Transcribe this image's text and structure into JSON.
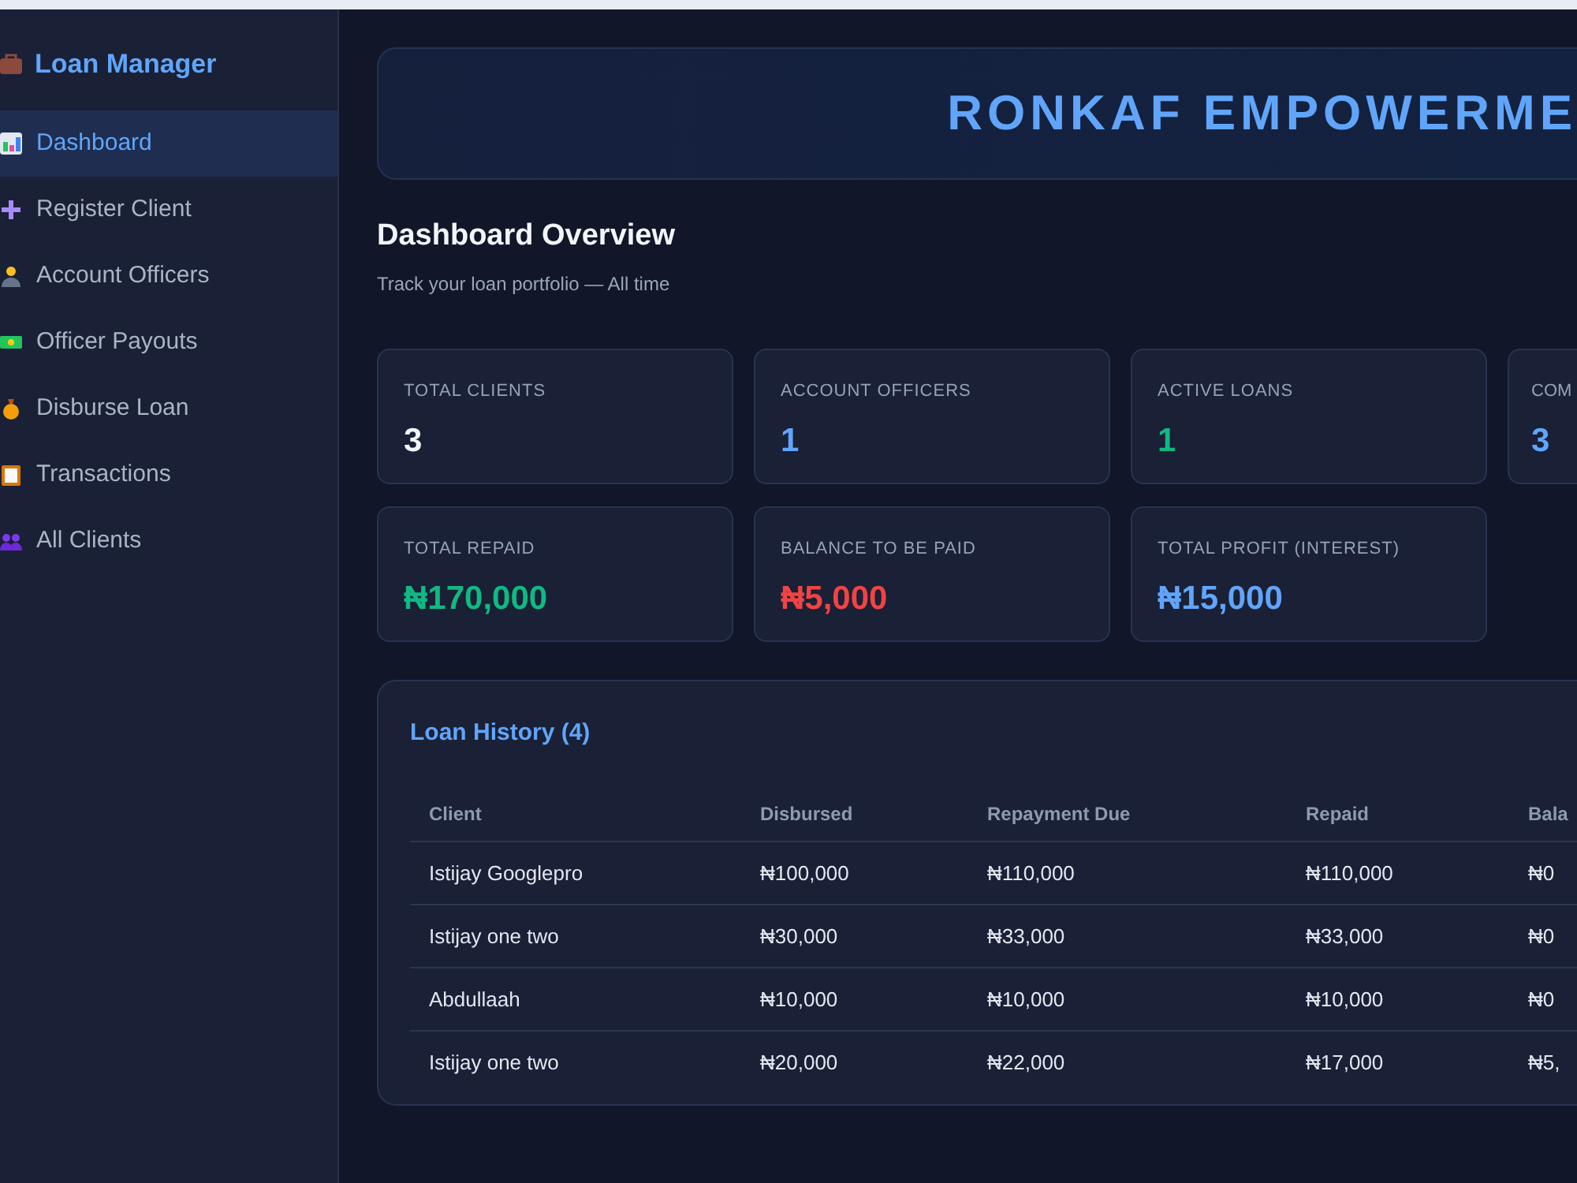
{
  "sidebar": {
    "title": "Loan Manager",
    "items": [
      {
        "label": "Dashboard",
        "selected": true
      },
      {
        "label": "Register Client",
        "selected": false
      },
      {
        "label": "Account Officers",
        "selected": false
      },
      {
        "label": "Officer Payouts",
        "selected": false
      },
      {
        "label": "Disburse Loan",
        "selected": false
      },
      {
        "label": "Transactions",
        "selected": false
      },
      {
        "label": "All Clients",
        "selected": false
      }
    ]
  },
  "banner": {
    "title": "RONKAF EMPOWERME"
  },
  "header": {
    "title": "Dashboard Overview",
    "subtitle": "Track your loan portfolio — All time"
  },
  "stats": [
    [
      {
        "label": "TOTAL CLIENTS",
        "value": "3",
        "color": "#f1f5f9"
      },
      {
        "label": "ACCOUNT OFFICERS",
        "value": "1",
        "color": "#60a5fa"
      },
      {
        "label": "ACTIVE LOANS",
        "value": "1",
        "color": "#10b981"
      },
      {
        "label": "COM",
        "value": "3",
        "color": "#60a5fa"
      }
    ],
    [
      {
        "label": "TOTAL REPAID",
        "value": "₦170,000",
        "color": "#10b981"
      },
      {
        "label": "BALANCE TO BE PAID",
        "value": "₦5,000",
        "color": "#ef4444"
      },
      {
        "label": "TOTAL PROFIT (INTEREST)",
        "value": "₦15,000",
        "color": "#60a5fa"
      }
    ]
  ],
  "loan_history": {
    "title": "Loan History (4)",
    "columns": [
      "Client",
      "Disbursed",
      "Repayment Due",
      "Repaid",
      "Bala"
    ],
    "rows": [
      [
        "Istijay Googlepro",
        "₦100,000",
        "₦110,000",
        "₦110,000",
        "₦0"
      ],
      [
        "Istijay one two",
        "₦30,000",
        "₦33,000",
        "₦33,000",
        "₦0"
      ],
      [
        "Abdullaah",
        "₦10,000",
        "₦10,000",
        "₦10,000",
        "₦0"
      ],
      [
        "Istijay one two",
        "₦20,000",
        "₦22,000",
        "₦17,000",
        "₦5,"
      ]
    ]
  }
}
